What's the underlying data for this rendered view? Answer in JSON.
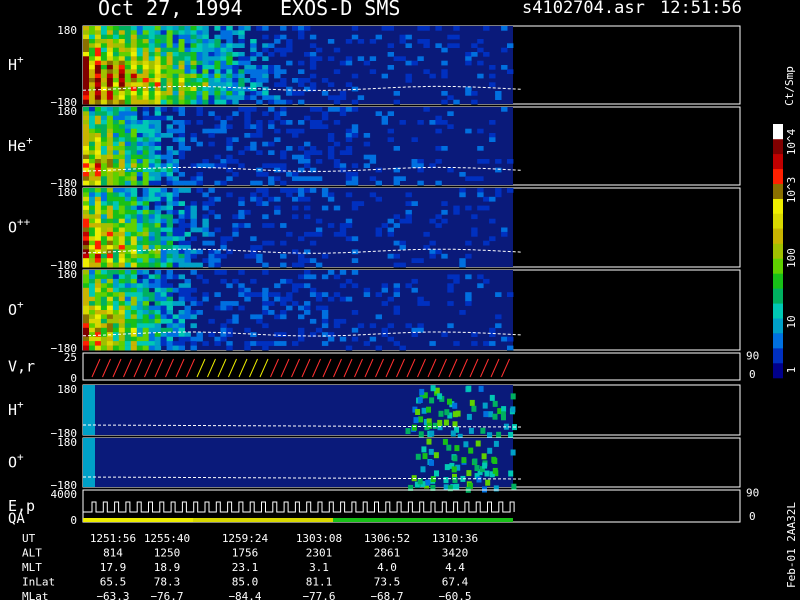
{
  "header": {
    "date": "Oct 27, 1994",
    "instrument": "EXOS-D SMS",
    "file": "s4102704.asr",
    "time": "12:51:56"
  },
  "colorbar": {
    "unit": "Ct/Smp",
    "ticks": [
      "1",
      "10",
      "100",
      "10^3",
      "10^4"
    ],
    "colors": [
      "#00008b",
      "#0030c0",
      "#0070e0",
      "#00a0c8",
      "#00c8b4",
      "#00b060",
      "#18c018",
      "#60d000",
      "#a0c000",
      "#c8b400",
      "#d8d800",
      "#eeee00",
      "#8a7000",
      "#ff2000",
      "#c00000",
      "#800000",
      "#ffffff"
    ]
  },
  "panels": [
    {
      "id": "H+",
      "label": "H",
      "sup": "+",
      "ymax": "180",
      "ymin": "−180",
      "type": "spectrogram",
      "fill": 1.0,
      "decay": 0.03
    },
    {
      "id": "He+",
      "label": "He",
      "sup": "+",
      "ymax": "180",
      "ymin": "−180",
      "type": "spectrogram",
      "fill": 0.8,
      "decay": 0.055
    },
    {
      "id": "O++",
      "label": "O",
      "sup": "++",
      "ymax": "180",
      "ymin": "−180",
      "type": "spectrogram",
      "fill": 0.85,
      "decay": 0.045
    },
    {
      "id": "O+",
      "label": "O",
      "sup": "+",
      "ymax": "180",
      "ymin": "−180",
      "type": "spectrogram",
      "fill": 0.85,
      "decay": 0.05
    },
    {
      "id": "Vr",
      "label": "V,r",
      "ymax": "25",
      "ymin": "0",
      "right_max": "90",
      "right_min": "0",
      "type": "line"
    },
    {
      "id": "H+2",
      "label": "H",
      "sup": "+",
      "ymax": "180",
      "ymin": "−180",
      "type": "sparse"
    },
    {
      "id": "O+2",
      "label": "O",
      "sup": "+",
      "ymax": "180",
      "ymin": "−180",
      "type": "sparse"
    },
    {
      "id": "Ep",
      "label": "E,p",
      "label2": "QA",
      "ymax": "4000",
      "ymin": "0",
      "right_max": "90",
      "right_min": "0",
      "type": "steps"
    }
  ],
  "footer": {
    "rows": [
      {
        "label": "UT",
        "values": [
          "1251:56",
          "1255:40",
          "1259:24",
          "1303:08",
          "1306:52",
          "1310:36"
        ]
      },
      {
        "label": "ALT",
        "values": [
          "814",
          "1250",
          "1756",
          "2301",
          "2861",
          "3420"
        ]
      },
      {
        "label": "MLT",
        "values": [
          "17.9",
          "18.9",
          "23.1",
          "3.1",
          "4.0",
          "4.4"
        ]
      },
      {
        "label": "InLat",
        "values": [
          "65.5",
          "78.3",
          "85.0",
          "81.1",
          "73.5",
          "67.4"
        ]
      },
      {
        "label": "MLat",
        "values": [
          "−63.3",
          "−76.7",
          "−84.4",
          "−77.6",
          "−68.7",
          "−60.5"
        ]
      }
    ],
    "side_label": "Feb-01 2AA32L"
  }
}
